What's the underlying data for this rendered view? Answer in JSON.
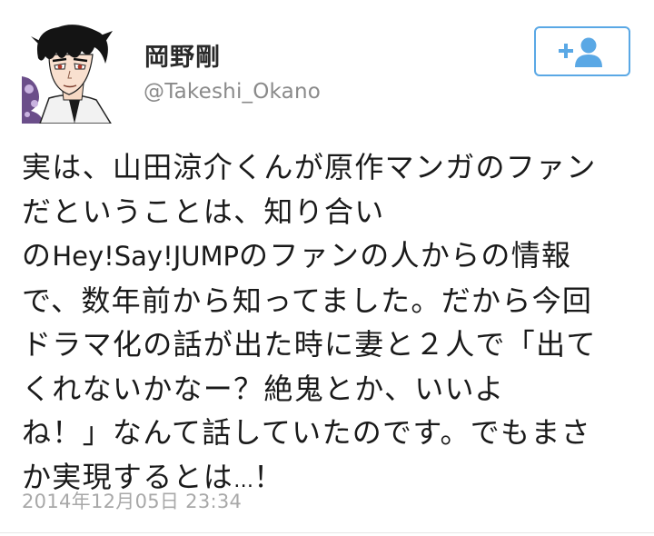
{
  "profile": {
    "display_name": "岡野剛",
    "handle": "@Takeshi_Okano"
  },
  "follow_button": {
    "icon": "add-user-icon",
    "color": "#5aa8e5"
  },
  "tweet": {
    "lines": [
      [
        "実は、山田涼介くんが原作マンガのファン"
      ],
      [
        "だということは、知り合い"
      ],
      [
        "の",
        "Hey!Say!JUMP",
        "のファンの人からの情報"
      ],
      [
        "で、数年前から知ってました。だから今回"
      ],
      [
        "ドラマ化の話が出た時に妻と２人で「出て"
      ],
      [
        "くれないかなー？絶鬼とか、いいよ"
      ],
      [
        "ね！」なんて話していたのです。でもまさ"
      ],
      [
        "か実現するとは",
        "…",
        "！"
      ]
    ],
    "timestamp": "2014年12月05日 23:34"
  }
}
